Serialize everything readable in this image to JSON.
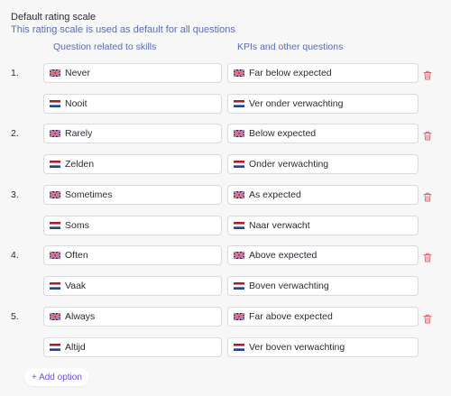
{
  "header": {
    "title": "Default rating scale",
    "subtitle": "This rating scale is used as default for all questions"
  },
  "columns": {
    "skills": "Question related to skills",
    "kpis": "KPIs and other questions"
  },
  "options": [
    {
      "number": "1.",
      "skills_en": "Never",
      "skills_nl": "Nooit",
      "kpi_en": "Far below expected",
      "kpi_nl": "Ver onder verwachting"
    },
    {
      "number": "2.",
      "skills_en": "Rarely",
      "skills_nl": "Zelden",
      "kpi_en": "Below expected",
      "kpi_nl": "Onder verwachting"
    },
    {
      "number": "3.",
      "skills_en": "Sometimes",
      "skills_nl": "Soms",
      "kpi_en": "As expected",
      "kpi_nl": "Naar verwacht"
    },
    {
      "number": "4.",
      "skills_en": "Often",
      "skills_nl": "Vaak",
      "kpi_en": "Above expected",
      "kpi_nl": "Boven verwachting"
    },
    {
      "number": "5.",
      "skills_en": "Always",
      "skills_nl": "Altijd",
      "kpi_en": "Far above expected",
      "kpi_nl": "Ver boven verwachting"
    }
  ],
  "add_option_label": "+ Add option",
  "icons": {
    "english": "uk-flag-icon",
    "dutch": "nl-flag-icon",
    "delete": "trash-icon"
  },
  "colors": {
    "accent": "#6a4fe0",
    "subtitle": "#5b6bb5",
    "delete": "#e0606a"
  }
}
